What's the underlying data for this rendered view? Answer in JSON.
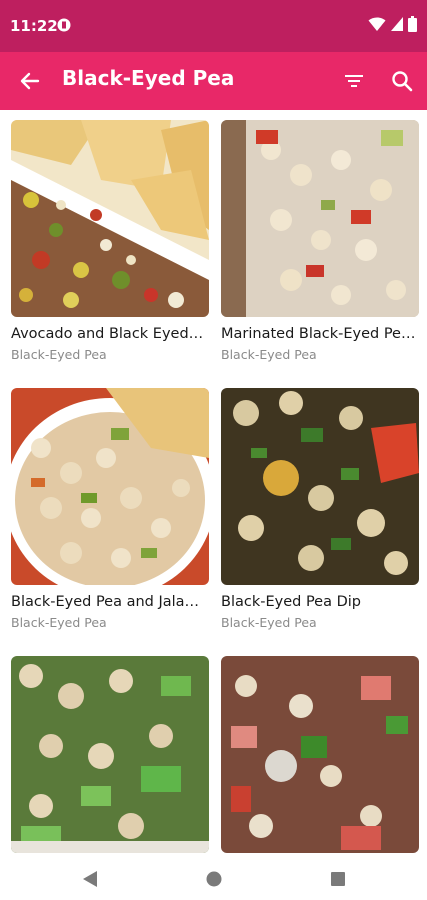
{
  "status_bar": {
    "time": "11:22",
    "app_icon": "app-notification-icon",
    "icons": [
      "wifi-icon",
      "signal-icon",
      "battery-icon"
    ]
  },
  "app_bar": {
    "title": "Black-Eyed Pea",
    "back_icon": "back-arrow-icon",
    "filter_icon": "filter-icon",
    "search_icon": "search-icon",
    "color": "#e82868",
    "status_color": "#be1f5f"
  },
  "recipes": [
    {
      "name": "Avocado and Black Eyed Pea Salsa",
      "category": "Black-Eyed Pea"
    },
    {
      "name": "Marinated Black-Eyed Peas",
      "category": "Black-Eyed Pea"
    },
    {
      "name": "Black-Eyed Pea and Jalapeño Dip",
      "category": "Black-Eyed Pea"
    },
    {
      "name": "Black-Eyed Pea Dip",
      "category": "Black-Eyed Pea"
    },
    {
      "name": "",
      "category": ""
    },
    {
      "name": "",
      "category": ""
    }
  ],
  "nav": {
    "back": "nav-back-icon",
    "home": "nav-home-icon",
    "recents": "nav-recents-icon"
  }
}
